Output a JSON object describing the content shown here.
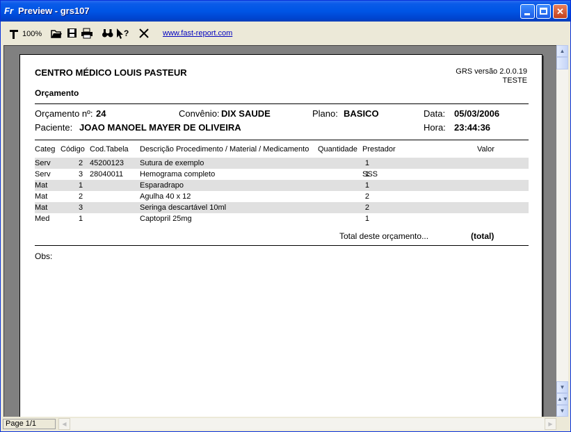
{
  "window": {
    "title": "Preview - grs107",
    "app_icon": "fast-report-icon"
  },
  "toolbar": {
    "zoom": "100%",
    "link": "www.fast-report.com",
    "icons": [
      "zoom-icon",
      "open-icon",
      "save-icon",
      "print-icon",
      "find-icon",
      "help-icon",
      "close-preview-icon"
    ]
  },
  "report": {
    "company": "CENTRO MÉDICO LOUIS PASTEUR",
    "version": "GRS versão 2.0.0.19",
    "mode": "TESTE",
    "doc_title": "Orçamento",
    "orcamento_label": "Orçamento nº:",
    "orcamento_value": "24",
    "convenio_label": "Convênio:",
    "convenio_value": "DIX SAUDE",
    "plano_label": "Plano:",
    "plano_value": "BASICO",
    "data_label": "Data:",
    "data_value": "05/03/2006",
    "paciente_label": "Paciente:",
    "paciente_value": "JOAO MANOEL MAYER DE OLIVEIRA",
    "hora_label": "Hora:",
    "hora_value": "23:44:36",
    "columns": {
      "categ": "Categ",
      "codigo": "Código",
      "cod_tabela": "Cod.Tabela",
      "descricao": "Descrição Procedimento / Material / Medicamento",
      "quantidade": "Quantidade",
      "prestador": "Prestador",
      "valor": "Valor"
    },
    "rows": [
      {
        "categ": "Serv",
        "codigo": "2",
        "cod_tabela": "45200123",
        "descricao": "Sutura de exemplo",
        "quantidade": "1",
        "prestador": ""
      },
      {
        "categ": "Serv",
        "codigo": "3",
        "cod_tabela": "28040011",
        "descricao": "Hemograma completo",
        "quantidade": "1",
        "prestador": "SSS"
      },
      {
        "categ": "Mat",
        "codigo": "1",
        "cod_tabela": "",
        "descricao": "Esparadrapo",
        "quantidade": "1",
        "prestador": ""
      },
      {
        "categ": "Mat",
        "codigo": "2",
        "cod_tabela": "",
        "descricao": "Agulha 40 x 12",
        "quantidade": "2",
        "prestador": ""
      },
      {
        "categ": "Mat",
        "codigo": "3",
        "cod_tabela": "",
        "descricao": "Seringa descartável 10ml",
        "quantidade": "2",
        "prestador": ""
      },
      {
        "categ": "Med",
        "codigo": "1",
        "cod_tabela": "",
        "descricao": "Captopril 25mg",
        "quantidade": "1",
        "prestador": ""
      }
    ],
    "total_label": "Total deste orçamento...",
    "total_value": "(total)",
    "obs_label": "Obs:"
  },
  "status": {
    "page": "Page 1/1"
  }
}
